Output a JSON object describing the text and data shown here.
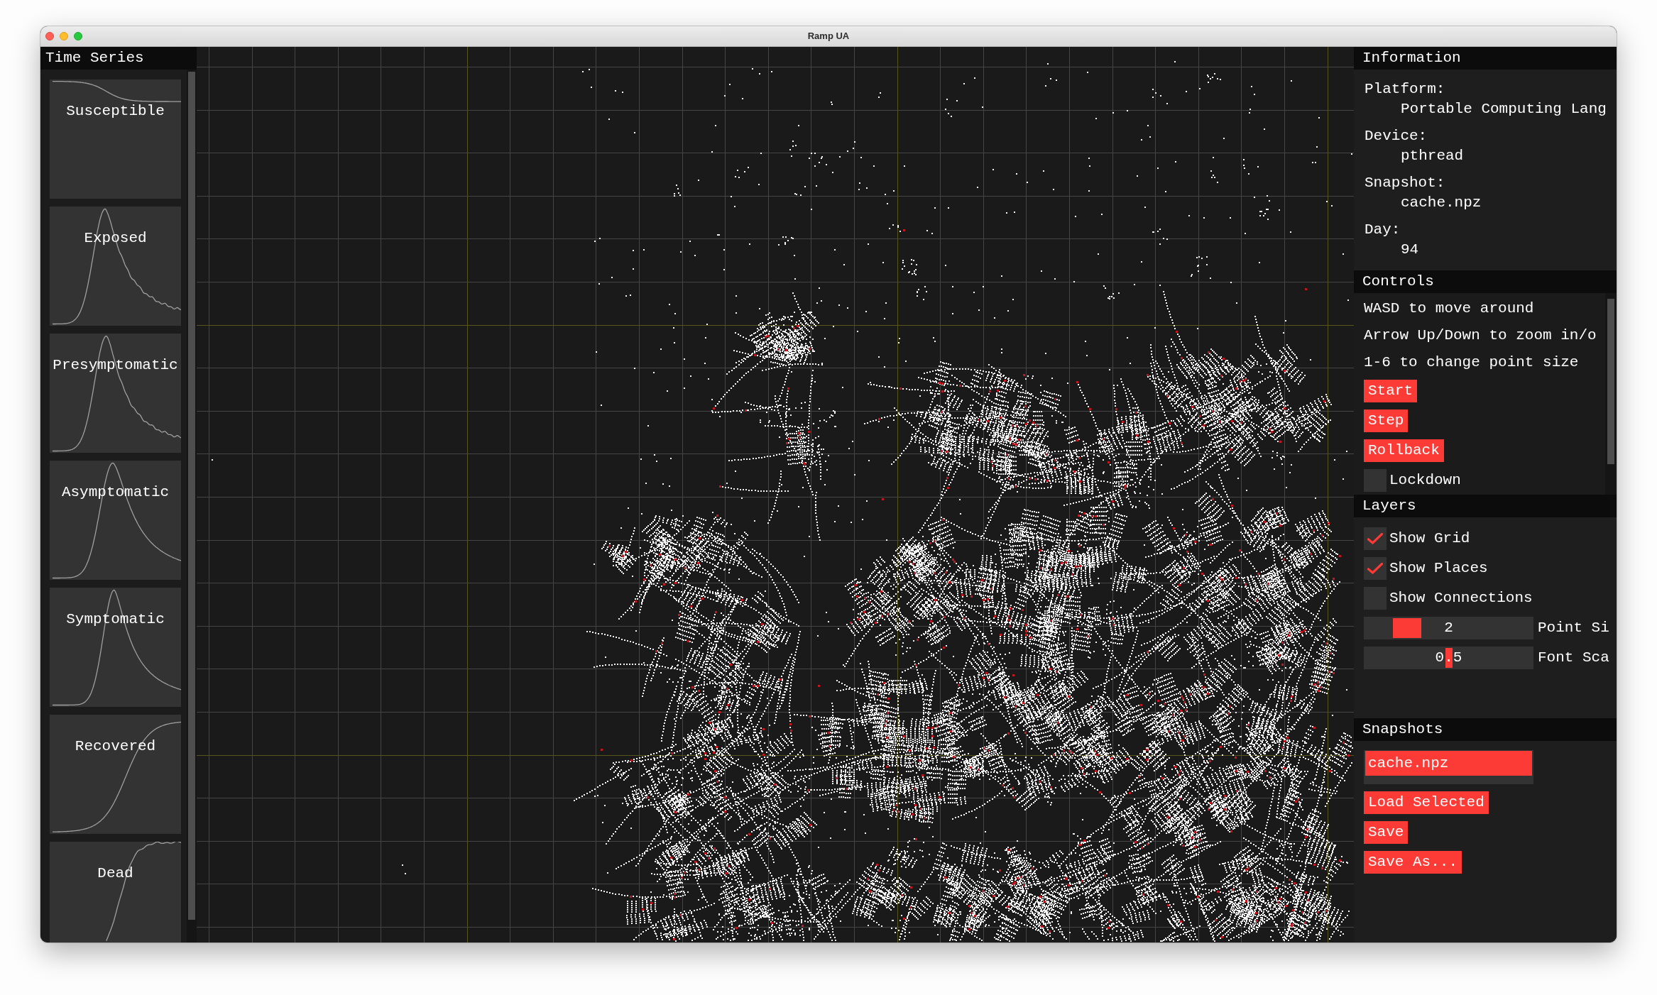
{
  "window": {
    "title": "Ramp UA"
  },
  "time_series": {
    "title": "Time Series",
    "charts": [
      {
        "label": "Susceptible",
        "kind": "falling"
      },
      {
        "label": "Exposed",
        "kind": "peak"
      },
      {
        "label": "Presymptomatic",
        "kind": "peak"
      },
      {
        "label": "Asymptomatic",
        "kind": "peak"
      },
      {
        "label": "Symptomatic",
        "kind": "peak"
      },
      {
        "label": "Recovered",
        "kind": "rising"
      },
      {
        "label": "Dead",
        "kind": "rising"
      }
    ]
  },
  "information": {
    "title": "Information",
    "items": [
      {
        "label": "Platform:",
        "value": "Portable Computing Lang"
      },
      {
        "label": "Device:",
        "value": "pthread"
      },
      {
        "label": "Snapshot:",
        "value": "cache.npz"
      },
      {
        "label": "Day:",
        "value": "94"
      }
    ]
  },
  "controls": {
    "title": "Controls",
    "hints": [
      "WASD to move around",
      "Arrow Up/Down to zoom in/o",
      "1-6 to change point size"
    ],
    "buttons": [
      "Start",
      "Step",
      "Rollback"
    ],
    "checkboxes": [
      {
        "label": "Lockdown",
        "checked": false
      }
    ]
  },
  "layers": {
    "title": "Layers",
    "checkboxes": [
      {
        "label": "Show Grid",
        "checked": true
      },
      {
        "label": "Show Places",
        "checked": true
      },
      {
        "label": "Show Connections",
        "checked": false
      }
    ],
    "sliders": [
      {
        "kind": "stepped",
        "value": "2",
        "label": "Point Si",
        "level": 0.2
      },
      {
        "kind": "continuous",
        "value": "0.5",
        "label": "Font Sca",
        "level": 0.5
      }
    ]
  },
  "snapshots": {
    "title": "Snapshots",
    "files": [
      {
        "label": "cache.npz",
        "selected": true
      }
    ],
    "buttons": [
      "Load Selected",
      "Save",
      "Save As..."
    ]
  }
}
